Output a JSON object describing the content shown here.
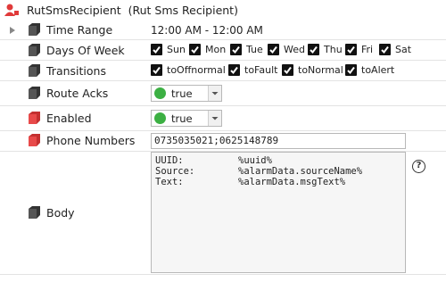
{
  "header": {
    "title": "RutSmsRecipient",
    "subtitle": "(Rut Sms Recipient)",
    "icon": "recipient-person-icon"
  },
  "properties": {
    "time_range": {
      "label": "Time Range",
      "value": "12:00 AM - 12:00 AM"
    },
    "days_of_week": {
      "label": "Days Of Week",
      "days": [
        {
          "label": "Sun",
          "checked": true
        },
        {
          "label": "Mon",
          "checked": true
        },
        {
          "label": "Tue",
          "checked": true
        },
        {
          "label": "Wed",
          "checked": true
        },
        {
          "label": "Thu",
          "checked": true
        },
        {
          "label": "Fri",
          "checked": true
        },
        {
          "label": "Sat",
          "checked": true
        }
      ]
    },
    "transitions": {
      "label": "Transitions",
      "items": [
        {
          "label": "toOffnormal",
          "checked": true
        },
        {
          "label": "toFault",
          "checked": true
        },
        {
          "label": "toNormal",
          "checked": true
        },
        {
          "label": "toAlert",
          "checked": true
        }
      ]
    },
    "route_acks": {
      "label": "Route Acks",
      "value": "true"
    },
    "enabled": {
      "label": "Enabled",
      "value": "true"
    },
    "phone_numbers": {
      "label": "Phone Numbers",
      "value": "0735035021;0625148789"
    },
    "body": {
      "label": "Body",
      "lines": [
        {
          "key": "UUID:",
          "value": "%uuid%"
        },
        {
          "key": "Source:",
          "value": "%alarmData.sourceName%"
        },
        {
          "key": "Text:",
          "value": "%alarmData.msgText%"
        }
      ],
      "help": "?"
    }
  },
  "colors": {
    "true_dot": "#3cb043",
    "red_slot_icon": "#e84a4a",
    "dark_slot_icon": "#333333"
  }
}
